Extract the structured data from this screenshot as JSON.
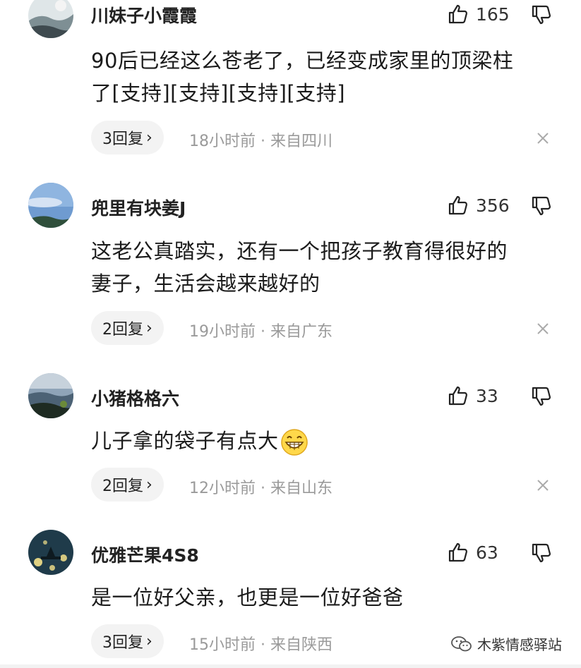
{
  "comments": [
    {
      "username": "川妹子小霞霞",
      "likes": "165",
      "lines": [
        "90后已经这么苍老了，已经变成家里的顶梁柱",
        "了[支持][支持][支持][支持]"
      ],
      "reply_label": "3回复",
      "time": "18小时前",
      "location": "来自四川"
    },
    {
      "username": "兜里有块姜J",
      "likes": "356",
      "lines": [
        "这老公真踏实，还有一个把孩子教育得很好的",
        "妻子，生活会越来越好的"
      ],
      "reply_label": "2回复",
      "time": "19小时前",
      "location": "来自广东"
    },
    {
      "username": "小猪格格六",
      "likes": "33",
      "lines": [
        "儿子拿的袋子有点大"
      ],
      "reply_label": "2回复",
      "time": "12小时前",
      "location": "来自山东"
    },
    {
      "username": "优雅芒果4S8",
      "likes": "63",
      "lines": [
        "是一位好父亲，也更是一位好爸爸"
      ],
      "reply_label": "3回复",
      "time": "15小时前",
      "location": "来自陕西"
    }
  ],
  "meta_separator": " · ",
  "watermark": "木紫情感驿站"
}
